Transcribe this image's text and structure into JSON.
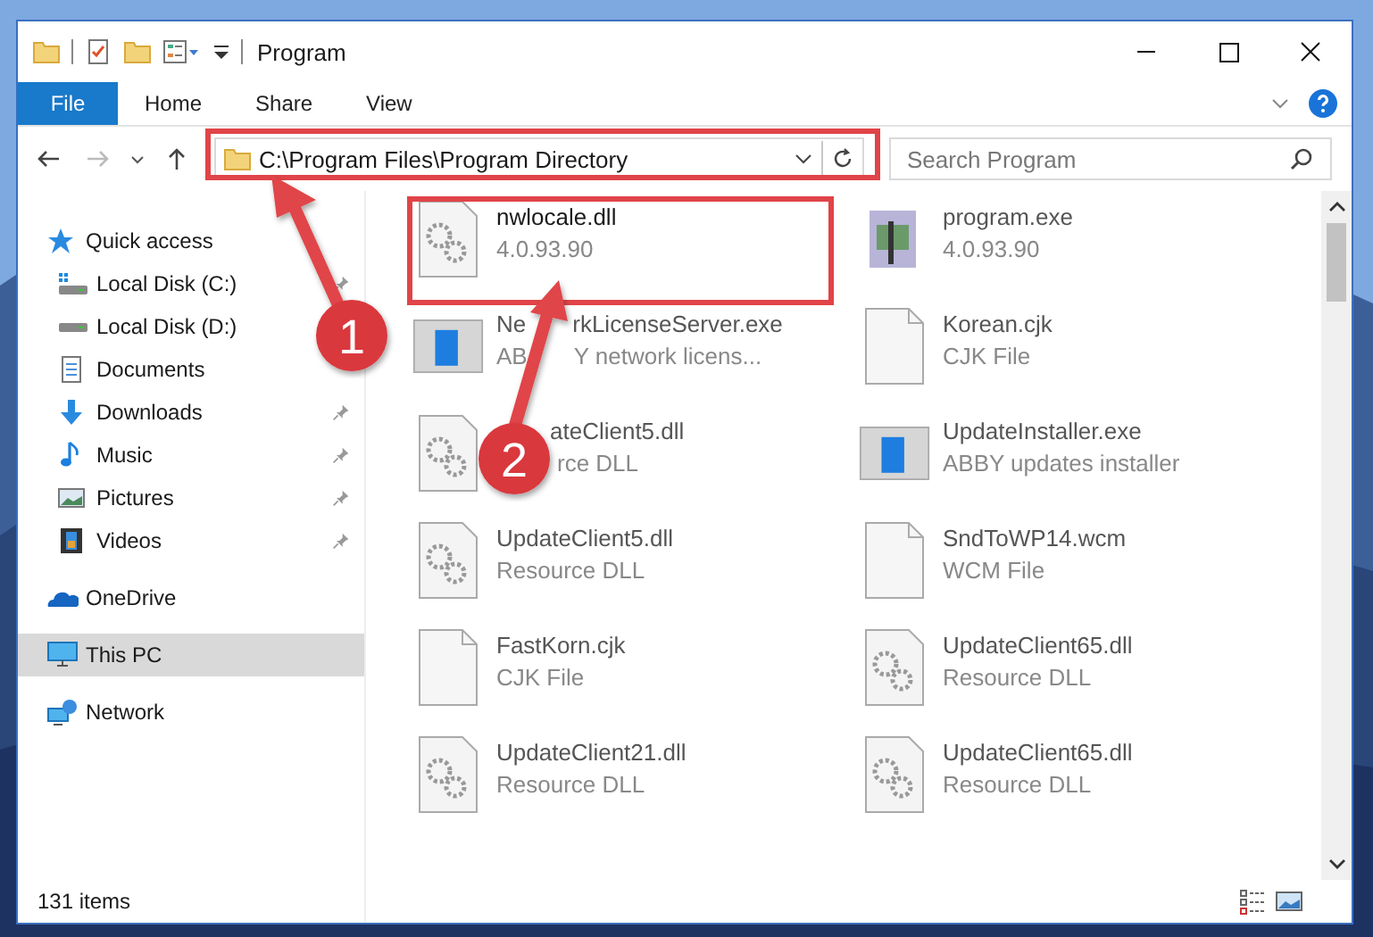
{
  "window": {
    "title": "Program"
  },
  "ribbon_tabs": [
    {
      "label": "File",
      "kind": "file"
    },
    {
      "label": "Home",
      "kind": "tab"
    },
    {
      "label": "Share",
      "kind": "tab"
    },
    {
      "label": "View",
      "kind": "tab"
    }
  ],
  "address": {
    "path": "C:\\Program Files\\Program Directory"
  },
  "search": {
    "placeholder": "Search Program"
  },
  "sidebar": {
    "items": [
      {
        "label": "Quick access",
        "kind": "star",
        "selected": false,
        "children": [
          {
            "label": "Local Disk (C:)",
            "kind": "disk-c",
            "pinned": true,
            "selected": false
          },
          {
            "label": "Local Disk (D:)",
            "kind": "disk",
            "pinned": false,
            "selected": false
          },
          {
            "label": "Documents",
            "kind": "documents",
            "pinned": false,
            "selected": false
          },
          {
            "label": "Downloads",
            "kind": "downloads",
            "pinned": true,
            "selected": false
          },
          {
            "label": "Music",
            "kind": "music",
            "pinned": true,
            "selected": false
          },
          {
            "label": "Pictures",
            "kind": "pictures",
            "pinned": true,
            "selected": false
          },
          {
            "label": "Videos",
            "kind": "videos",
            "pinned": true,
            "selected": false
          }
        ]
      },
      {
        "label": "OneDrive",
        "kind": "cloud",
        "selected": false
      },
      {
        "label": "This PC",
        "kind": "pc",
        "selected": true
      },
      {
        "label": "Network",
        "kind": "network",
        "selected": false
      }
    ]
  },
  "files": [
    {
      "name": [
        "nwlocale.dll"
      ],
      "detail": [
        "4.0.93.90"
      ],
      "kind": "dll"
    },
    {
      "name": [
        "program.exe"
      ],
      "detail": [
        "4.0.93.90"
      ],
      "kind": "program"
    },
    {
      "name": [
        "Ne",
        "rkLicenseServer.exe"
      ],
      "detail": [
        "AB",
        "Y network licens..."
      ],
      "kind": "app"
    },
    {
      "name": [
        "Korean.cjk"
      ],
      "detail": [
        "CJK File"
      ],
      "kind": "blank"
    },
    {
      "name": [
        "ateClient5.dll"
      ],
      "detail": [
        "rce DLL"
      ],
      "kind": "dll"
    },
    {
      "name": [
        "UpdateInstaller.exe"
      ],
      "detail": [
        "ABBY updates installer"
      ],
      "kind": "app"
    },
    {
      "name": [
        "UpdateClient5.dll"
      ],
      "detail": [
        "Resource DLL"
      ],
      "kind": "dll"
    },
    {
      "name": [
        "SndToWP14.wcm"
      ],
      "detail": [
        "WCM File"
      ],
      "kind": "blank"
    },
    {
      "name": [
        "FastKorn.cjk"
      ],
      "detail": [
        "CJK File"
      ],
      "kind": "blank"
    },
    {
      "name": [
        "UpdateClient65.dll"
      ],
      "detail": [
        "Resource DLL"
      ],
      "kind": "dll"
    },
    {
      "name": [
        "UpdateClient21.dll"
      ],
      "detail": [
        "Resource DLL"
      ],
      "kind": "dll"
    },
    {
      "name": [
        "UpdateClient65.dll"
      ],
      "detail": [
        "Resource DLL"
      ],
      "kind": "dll"
    }
  ],
  "status_bar": {
    "count": "131 items"
  },
  "annotations": [
    {
      "label": "1"
    },
    {
      "label": "2"
    }
  ]
}
